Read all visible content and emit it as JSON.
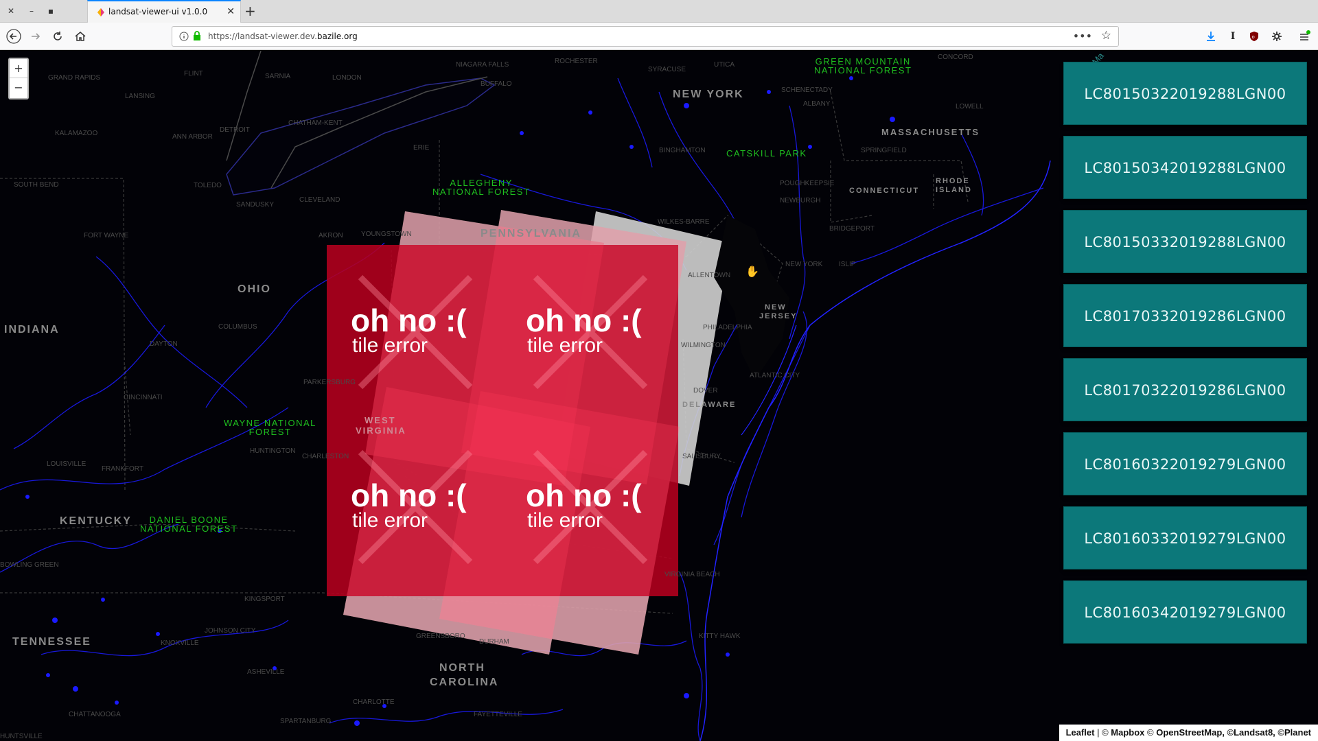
{
  "browser": {
    "tab_title": "landsat-viewer-ui v1.0.0",
    "url_prefix": "https://landsat-viewer.dev.",
    "url_domain": "bazile.org"
  },
  "map": {
    "states": [
      {
        "id": "new-york",
        "label": "NEW YORK"
      },
      {
        "id": "massachusetts",
        "label": "MASSACHUSETTS"
      },
      {
        "id": "connecticut",
        "label": "CONNECTICUT"
      },
      {
        "id": "rhode-island-1",
        "label": "RHODE"
      },
      {
        "id": "rhode-island-2",
        "label": "ISLAND"
      },
      {
        "id": "pennsylvania",
        "label": "PENNSYLVANIA"
      },
      {
        "id": "ohio",
        "label": "OHIO"
      },
      {
        "id": "indiana",
        "label": "INDIANA"
      },
      {
        "id": "new-jersey-1",
        "label": "NEW"
      },
      {
        "id": "new-jersey-2",
        "label": "JERSEY"
      },
      {
        "id": "delaware",
        "label": "DELAWARE"
      },
      {
        "id": "west-virginia-1",
        "label": "WEST"
      },
      {
        "id": "west-virginia-2",
        "label": "VIRGINIA"
      },
      {
        "id": "kentucky",
        "label": "KENTUCKY"
      },
      {
        "id": "tennessee",
        "label": "TENNESSEE"
      },
      {
        "id": "north-carolina-1",
        "label": "NORTH"
      },
      {
        "id": "north-carolina-2",
        "label": "CAROLINA"
      }
    ],
    "forests": [
      {
        "id": "green-mountain",
        "line1": "GREEN MOUNTAIN",
        "line2": "NATIONAL FOREST"
      },
      {
        "id": "catskill",
        "line1": "CATSKILL PARK",
        "line2": ""
      },
      {
        "id": "allegheny",
        "line1": "ALLEGHENY",
        "line2": "NATIONAL FOREST"
      },
      {
        "id": "wayne",
        "line1": "WAYNE NATIONAL",
        "line2": "FOREST"
      },
      {
        "id": "daniel-boone",
        "line1": "DANIEL BOONE",
        "line2": "NATIONAL FOREST"
      }
    ],
    "cities": [
      "GRAND RAPIDS",
      "LANSING",
      "KALAMAZOO",
      "ANN ARBOR",
      "DETROIT",
      "FLINT",
      "SARNIA",
      "LONDON",
      "CHATHAM-KENT",
      "NIAGARA FALLS",
      "BUFFALO",
      "ROCHESTER",
      "SYRACUSE",
      "UTICA",
      "ERIE",
      "BINGHAMTON",
      "SCHENECTADY",
      "ALBANY",
      "SOUTH BEND",
      "TOLEDO",
      "SANDUSKY",
      "CLEVELAND",
      "AKRON",
      "YOUNGSTOWN",
      "FORT WAYNE",
      "COLUMBUS",
      "DAYTON",
      "CINCINNATI",
      "PARKERSBURG",
      "HUNTINGTON",
      "CHARLESTON",
      "LOUISVILLE",
      "FRANKFORT",
      "BOWLING GREEN",
      "KINGSPORT",
      "JOHNSON CITY",
      "KNOXVILLE",
      "ASHEVILLE",
      "CHATTANOOGA",
      "HUNTSVILLE",
      "GREENSBORO",
      "DURHAM",
      "FAYETTEVILLE",
      "CHARLOTTE",
      "SPARTANBURG",
      "WILKES-BARRE",
      "ALLENTOWN",
      "PHILADELPHIA",
      "WILMINGTON",
      "DOVER",
      "SALISBURY",
      "ATLANTIC CITY",
      "NEW YORK",
      "ISLIP",
      "BRIDGEPORT",
      "NEWBURGH",
      "POUGHKEEPSIE",
      "SPRINGFIELD",
      "LOWELL",
      "CONCORD",
      "KITTY HAWK",
      "VIRGINIA BEACH"
    ],
    "gulf_label": "Gulf of Ma",
    "tile_error_headline": "oh no :(",
    "tile_error_subline": "tile error"
  },
  "zoom": {
    "in": "+",
    "out": "−"
  },
  "scenes": [
    "LC80150322019288LGN00",
    "LC80150342019288LGN00",
    "LC80150332019288LGN00",
    "LC80170332019286LGN00",
    "LC80170322019286LGN00",
    "LC80160322019279LGN00",
    "LC80160332019279LGN00",
    "LC80160342019279LGN00"
  ],
  "attribution": {
    "leaflet": "Leaflet",
    "sep": " | © ",
    "mapbox": "Mapbox",
    "osm_pre": " © ",
    "osm": "OpenStreetMap",
    "landsat": ", ©Landsat8, ",
    "planet": "©Planet"
  },
  "colors": {
    "scene_button": "#0c787a",
    "tile_error": "#b5001f",
    "water": "#1a1aff",
    "forest_label": "#1fbf1f"
  }
}
